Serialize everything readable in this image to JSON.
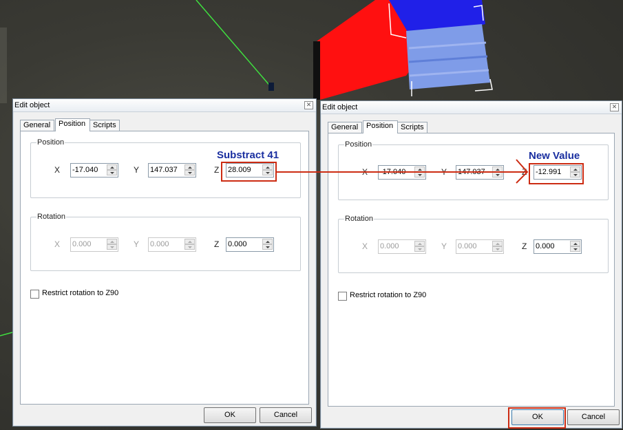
{
  "dialog_left": {
    "title": "Edit object",
    "tabs": [
      "General",
      "Position",
      "Scripts"
    ],
    "position_group": "Position",
    "rotation_group": "Rotation",
    "pos": {
      "x_label": "X",
      "x": "-17.040",
      "y_label": "Y",
      "y": "147.037",
      "z_label": "Z",
      "z": "28.009"
    },
    "rot": {
      "x_label": "X",
      "x": "0.000",
      "y_label": "Y",
      "y": "0.000",
      "z_label": "Z",
      "z": "0.000"
    },
    "restrict_label": "Restrict rotation to Z90",
    "ok": "OK",
    "cancel": "Cancel",
    "annotation": "Substract 41"
  },
  "dialog_right": {
    "title": "Edit object",
    "tabs": [
      "General",
      "Position",
      "Scripts"
    ],
    "position_group": "Position",
    "rotation_group": "Rotation",
    "pos": {
      "x_label": "X",
      "x": "-17.040",
      "y_label": "Y",
      "y": "147.037",
      "z_label": "Z",
      "z": "-12.991"
    },
    "rot": {
      "x_label": "X",
      "x": "0.000",
      "y_label": "Y",
      "y": "0.000",
      "z_label": "Z",
      "z": "0.000"
    },
    "restrict_label": "Restrict rotation to Z90",
    "ok": "OK",
    "cancel": "Cancel",
    "annotation": "New Value"
  },
  "colors": {
    "highlight": "#cc2b12",
    "annotation_text": "#1a2fa0",
    "arrow": "#cc2b12"
  }
}
